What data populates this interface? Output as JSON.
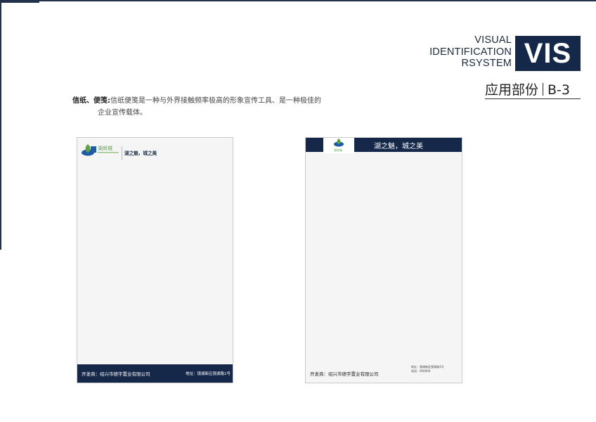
{
  "header": {
    "vis_lines": [
      "VISUAL",
      "IDENTIFICATION",
      "RSYSTEM"
    ],
    "vis_badge": "VIS",
    "section_name": "应用部份",
    "section_code": "B-3"
  },
  "description": {
    "heading": "信纸、便笺:",
    "line1": "信纸便笺是一种与外界接触频率极高的形象宣传工具、是一种极佳的",
    "line2": "企业宣传载体。"
  },
  "sheet_a": {
    "logo_text": "湖尚城",
    "slogan": "湖之魅，城之美",
    "developer": "开发商：绍兴市德宇置业有限公司",
    "address": "地址：镜湖新区镜湖路1号"
  },
  "sheet_b": {
    "logo_text": "湖尚城",
    "slogan": "湖之魅，城之美",
    "developer": "开发商：绍兴市德宇置业有限公司",
    "address_small": "地址：镜湖新区镜湖路1号",
    "phone_small": "电话：000000"
  },
  "colors": {
    "navy": "#16284a",
    "logo_green": "#5aa346",
    "logo_blue": "#1f5ca8"
  }
}
